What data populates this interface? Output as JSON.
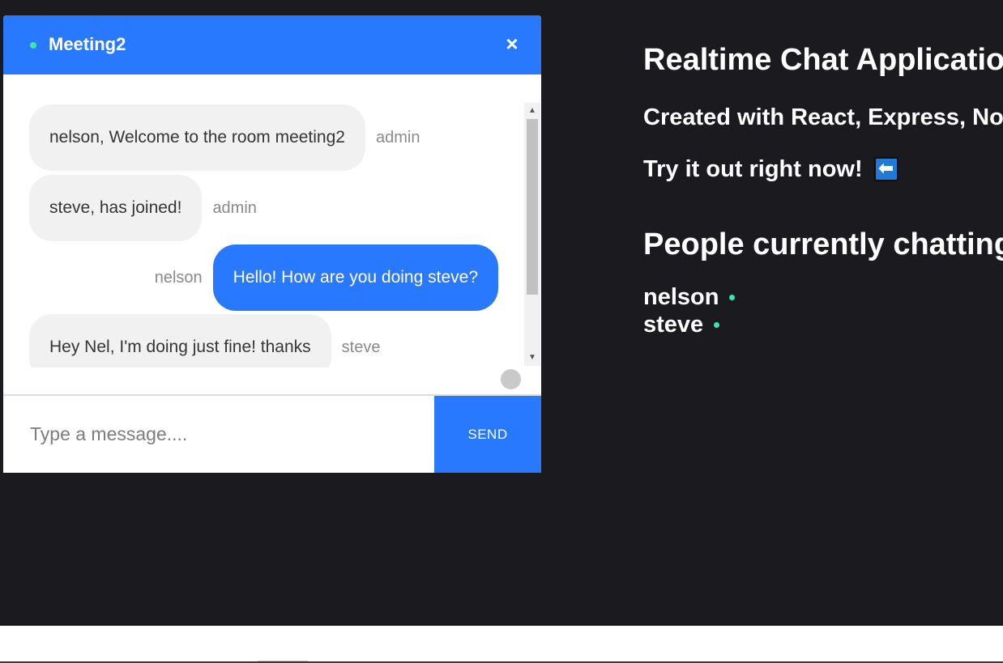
{
  "chat": {
    "room_name": "Meeting2",
    "close_label": "×",
    "messages": [
      {
        "text": "nelson, Welcome to the room meeting2",
        "sender": "admin",
        "own": false
      },
      {
        "text": "steve, has joined!",
        "sender": "admin",
        "own": false
      },
      {
        "text": "Hello! How are you doing steve?",
        "sender": "nelson",
        "own": true
      },
      {
        "text": "Hey Nel, I'm doing just fine! thanks",
        "sender": "steve",
        "own": false
      }
    ],
    "input_placeholder": "Type a message....",
    "input_value": "",
    "send_label": "SEND"
  },
  "info": {
    "title": "Realtime Chat Application",
    "subtitle": "Created with React, Express, Node and Socket.IO",
    "tryit": "Try it out right now!",
    "arrow": "⬅",
    "people_title": "People currently chatting:",
    "people": [
      "nelson",
      "steve"
    ]
  },
  "colors": {
    "accent": "#2979ff",
    "online": "#3ee6a8",
    "background": "#1b1b1f"
  },
  "icons": {
    "online": "online-dot-icon",
    "close": "close-icon",
    "arrow": "left-arrow-icon"
  }
}
